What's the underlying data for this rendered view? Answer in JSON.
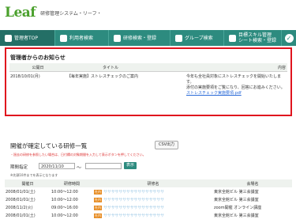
{
  "header": {
    "logo": "Leaf",
    "subtitle": "研修管理システム・リーフ・"
  },
  "nav": {
    "items": [
      {
        "label": "管理者TOP",
        "active": true
      },
      {
        "label": "利用者検索",
        "active": false
      },
      {
        "label": "研修検索・登録",
        "active": false
      },
      {
        "label": "グループ検索",
        "active": false
      },
      {
        "label": "目標スキル管理\nシート検索・登録",
        "active": false
      }
    ],
    "check_icon": "check-circle-icon"
  },
  "notice": {
    "title": "管理者からのお知らせ",
    "columns": [
      "公開日",
      "タイトル",
      "内容"
    ],
    "row": {
      "date": "2018/10/01(月)",
      "title": "【毎年実施】ストレスチェックのご案内",
      "content_line1": "今年も全社員対象にストレスチェックを開始いたします。",
      "content_line2": "添付の実施要項をご覧になり、回答にお進みください。",
      "link": "ストレスチェック実施要項.pdf"
    }
  },
  "trainings": {
    "title": "開催が確定している研修一覧",
    "csv_label": "CSV出力",
    "warning": "・過去の研修を参照したい場合は、日付欄の対象期間を入力して表示ボタンを押してください。",
    "period_label": "期間指定",
    "date_from": "2020/11/10",
    "tilde": "〜",
    "date_to": "",
    "show_label": "表示",
    "note": "※先頭10件までを表示となります",
    "columns": [
      "開催日",
      "研修時間",
      "研修名",
      "会場名"
    ],
    "rows": [
      {
        "date": "2008/01/01(土)",
        "time": "10:00〜12:00",
        "badge": "社内",
        "name": "ササササササササササササササササ",
        "venue": "東京全館ビル 第三会議室"
      },
      {
        "date": "2008/01/01(土)",
        "time": "10:00〜12:00",
        "badge": "社内",
        "name": "ササササササササササササササササ",
        "venue": "東京全館ビル 第三会議室"
      },
      {
        "date": "2008/11/2(火)",
        "time": "09:00〜16:00",
        "badge": "社内",
        "name": "ササササササササササササササササ",
        "venue": "zoom開催 オンライン講座"
      },
      {
        "date": "2008/01/01(土)",
        "time": "10:00〜12:00",
        "badge": "社内",
        "name": "ササササササササササササササササ",
        "venue": "東京全館ビル 第三会議室"
      }
    ]
  }
}
